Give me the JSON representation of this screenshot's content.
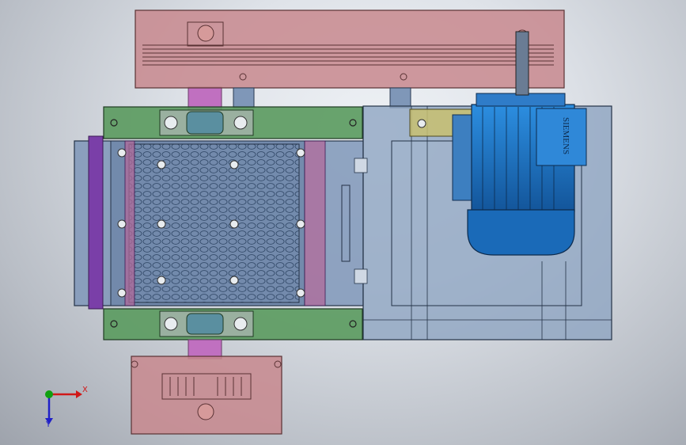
{
  "viewport": {
    "background": "#dfe3e9",
    "model_name": "SIEMENS"
  },
  "triad": {
    "x_label": "X",
    "y_label": "Y",
    "x_color": "#d01818",
    "y_color": "#2020c8",
    "z_color": "#10a010"
  },
  "colors": {
    "pulley_guard": "#c8888e",
    "bearing_plate": "#5a9a5e",
    "frame_blue": "#7f97b8",
    "motor_blue": "#1f78c8",
    "shaft_magenta": "#c070c0",
    "roller_purple": "#7a3fa8",
    "tension_yellow": "#c8c070"
  }
}
